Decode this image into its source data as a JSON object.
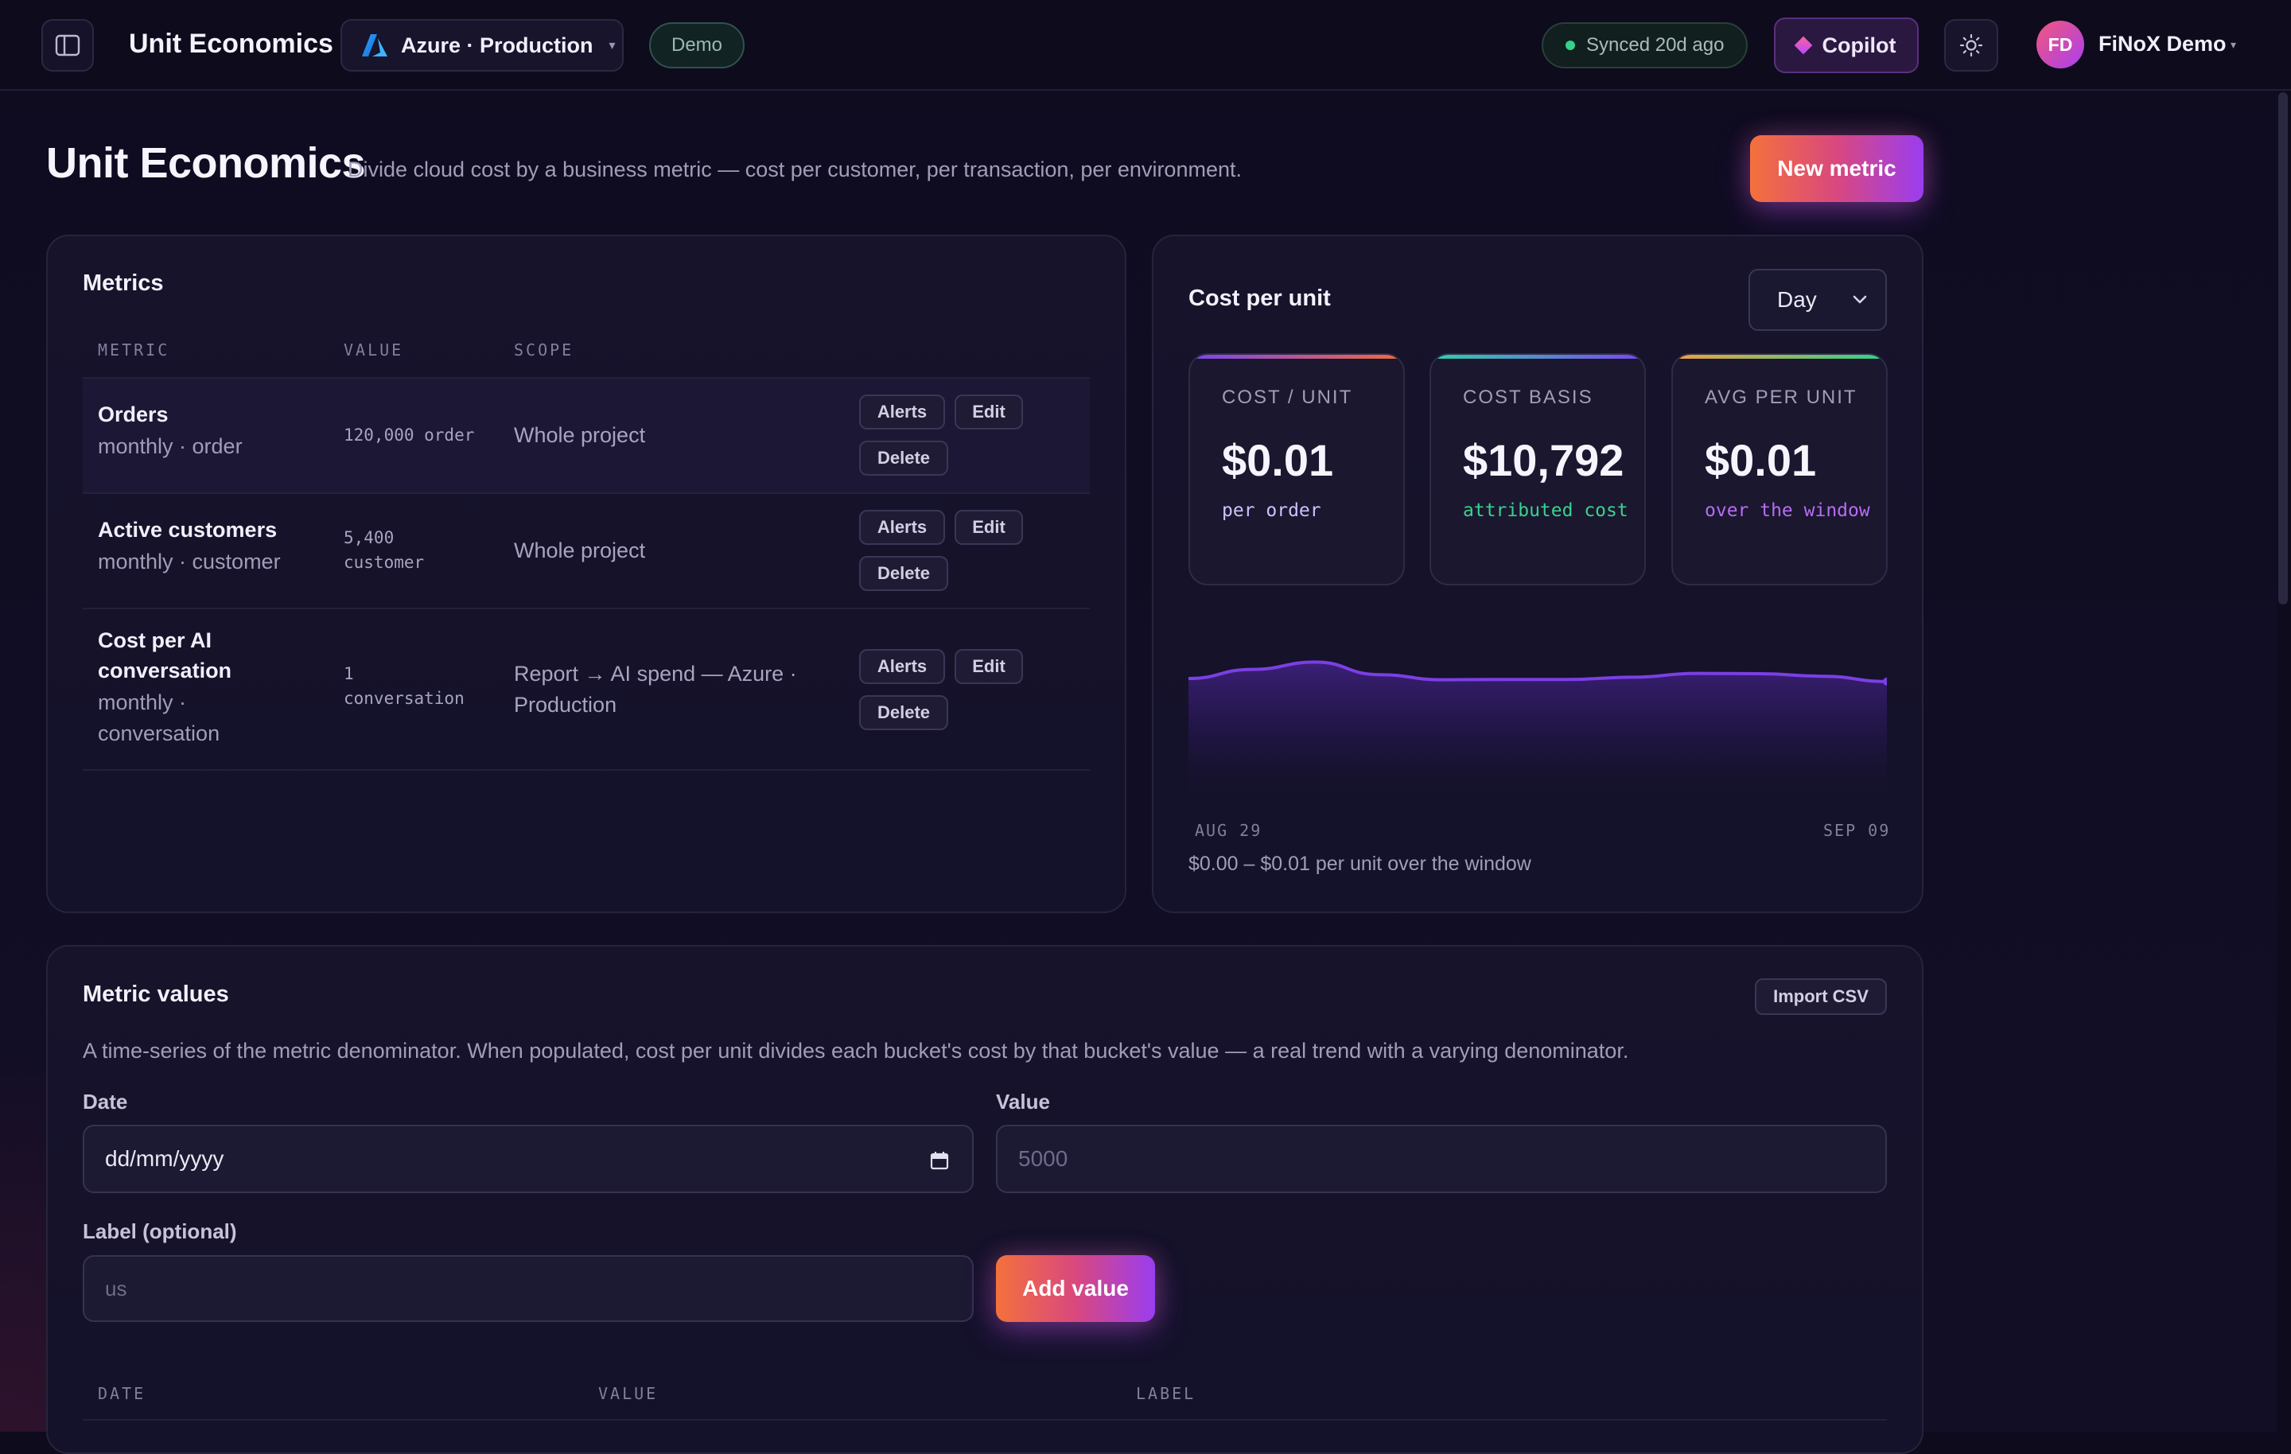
{
  "header": {
    "app_title": "Unit Economics",
    "project": "Azure · Production",
    "demo_badge": "Demo",
    "sync_status": "Synced 20d ago",
    "copilot_label": "Copilot",
    "user_initials": "FD",
    "user_name": "FiNoX Demo",
    "caret": "▾"
  },
  "page": {
    "title": "Unit Economics",
    "subtitle": "Divide cloud cost by a business metric — cost per customer, per transaction, per environment.",
    "new_metric_label": "New metric"
  },
  "metrics": {
    "title": "Metrics",
    "columns": [
      "METRIC",
      "VALUE",
      "SCOPE"
    ],
    "rows": [
      {
        "name_lines": [
          "Orders"
        ],
        "sub_lines": [
          "monthly · order"
        ],
        "value_lines": [
          "120,000 order"
        ],
        "scope_lines": [
          "Whole project"
        ],
        "selected": true
      },
      {
        "name_lines": [
          "Active customers"
        ],
        "sub_lines": [
          "monthly · customer"
        ],
        "value_lines": [
          "5,400",
          "customer"
        ],
        "scope_lines": [
          "Whole project"
        ],
        "selected": false
      },
      {
        "name_lines": [
          "Cost per AI",
          "conversation"
        ],
        "sub_lines": [
          "monthly ·",
          "conversation"
        ],
        "value_lines": [
          "1",
          "conversation"
        ],
        "scope_lines": [
          "Report → AI spend — Azure ·",
          "Production"
        ],
        "selected": false
      }
    ],
    "actions": {
      "alerts": "Alerts",
      "edit": "Edit",
      "delete": "Delete"
    }
  },
  "cost_per_unit": {
    "title": "Cost per unit",
    "period": "Day",
    "stats": [
      {
        "label": "COST / UNIT",
        "value": "$0.01",
        "note": "per order",
        "note_color": "#c9c4ff",
        "accent": [
          "#7a45f0",
          "#f06a3c"
        ]
      },
      {
        "label": "COST BASIS",
        "value": "$10,792",
        "note": "attributed cost",
        "note_color": "#3ad28c",
        "accent": [
          "#2fd1a8",
          "#7a45f0"
        ]
      },
      {
        "label": "AVG PER UNIT",
        "value": "$0.01",
        "note": "over the window",
        "note_color": "#b86cf5",
        "accent": [
          "#f0a040",
          "#2fd18c"
        ]
      }
    ],
    "x_start": "AUG 29",
    "x_end": "SEP 09",
    "range_note": "$0.00 – $0.01 per unit over the window"
  },
  "chart_data": {
    "type": "area",
    "title": "",
    "x_range": [
      "AUG 29",
      "SEP 09"
    ],
    "values": [
      0.00845,
      0.00902,
      0.00948,
      0.00869,
      0.00837,
      0.00839,
      0.00839,
      0.00853,
      0.00877,
      0.00875,
      0.00859,
      0.00826
    ],
    "ylim": [
      0,
      0.01
    ],
    "color": "#7b3fe4",
    "grid": false,
    "legend": "none"
  },
  "metric_values": {
    "title": "Metric values",
    "import_label": "Import CSV",
    "description": "A time-series of the metric denominator. When populated, cost per unit divides each bucket's cost by that bucket's value — a real trend with a varying denominator.",
    "date_label": "Date",
    "date_value": "dd/mm/yyyy",
    "value_label": "Value",
    "value_placeholder": "5000",
    "label_label": "Label (optional)",
    "label_placeholder": "us",
    "add_label": "Add value",
    "columns": [
      "DATE",
      "VALUE",
      "LABEL"
    ]
  }
}
